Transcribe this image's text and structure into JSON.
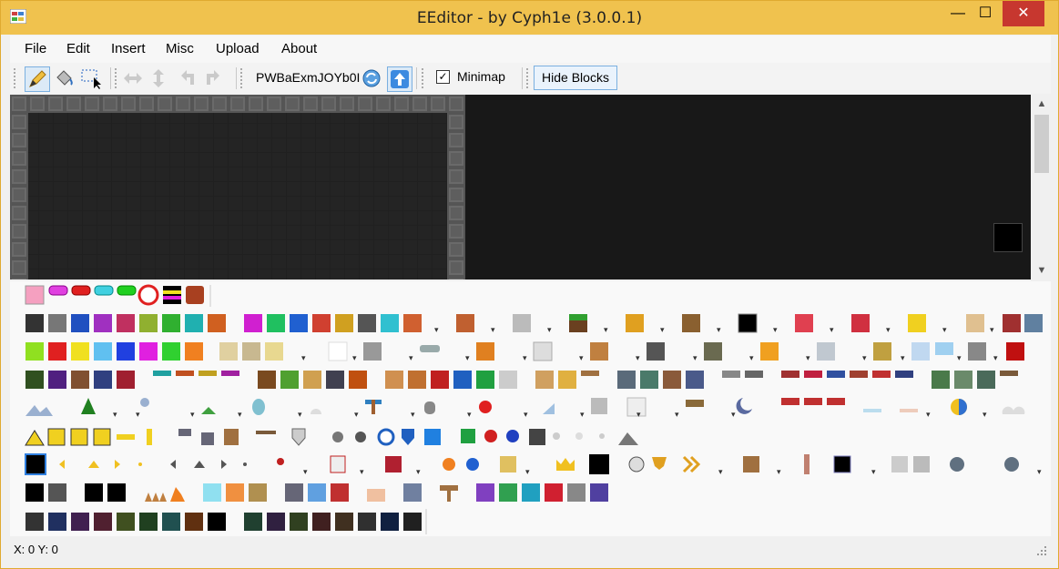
{
  "window": {
    "title": "EEditor - by Cyph1e (3.0.0.1)",
    "minimize": "—",
    "maximize": "☐",
    "close": "✕"
  },
  "menu": [
    "File",
    "Edit",
    "Insert",
    "Misc",
    "Upload",
    "About"
  ],
  "toolbar": {
    "tools": [
      "pencil-tool",
      "fill-tool",
      "select-tool",
      "flip-horizontal",
      "flip-vertical",
      "rotate-left",
      "rotate-right"
    ],
    "world_id": "PWBaExmJOYb0I",
    "minimap_label": "Minimap",
    "minimap_checked": "✓",
    "hide_blocks_label": "Hide Blocks"
  },
  "status": "X: 0 Y: 0",
  "colors": {
    "titlebar": "#f0c24e",
    "canvas": "#181818",
    "close": "#c7372f"
  }
}
